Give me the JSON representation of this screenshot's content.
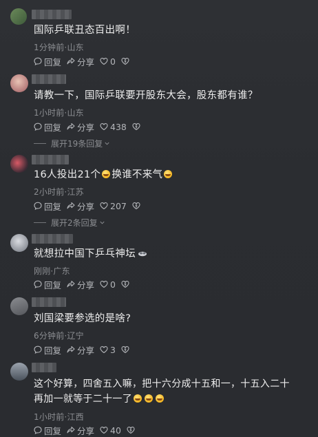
{
  "comments": [
    {
      "text": "国际乒联丑态百出啊！",
      "meta": "1分钟前·山东",
      "reply_label": "回复",
      "share_label": "分享",
      "likes": "0",
      "emojis": 0
    },
    {
      "text": "请教一下，国际乒联要开股东大会，股东都有谁？",
      "meta": "1小时前·山东",
      "reply_label": "回复",
      "share_label": "分享",
      "likes": "438",
      "expand": "展开19条回复"
    },
    {
      "text": "16人投出21个",
      "text_after": "换谁不来气",
      "meta": "2小时前·江苏",
      "reply_label": "回复",
      "share_label": "分享",
      "likes": "207",
      "expand": "展开2条回复"
    },
    {
      "text": "就想拉中国下乒乓神坛",
      "meta": "刚刚·广东",
      "reply_label": "回复",
      "share_label": "分享",
      "likes": "0"
    },
    {
      "text": "刘国梁要参选的是啥?",
      "meta": "6分钟前·辽宁",
      "reply_label": "回复",
      "share_label": "分享",
      "likes": "3"
    },
    {
      "text_line1": "这个好算，四舍五入嘛，把十六分成十五和一，十五入二十",
      "text_line2": "再加一就等于二十一了",
      "meta": "1小时前·江西",
      "reply_label": "回复",
      "share_label": "分享",
      "likes": "40"
    }
  ],
  "colors": {
    "background": "#2b2d31",
    "text": "#ededed",
    "meta": "#8b8d91"
  },
  "icons": [
    "reply-icon",
    "share-icon",
    "heart-icon",
    "dislike-icon",
    "emoji-icon",
    "chevron-down-icon"
  ]
}
